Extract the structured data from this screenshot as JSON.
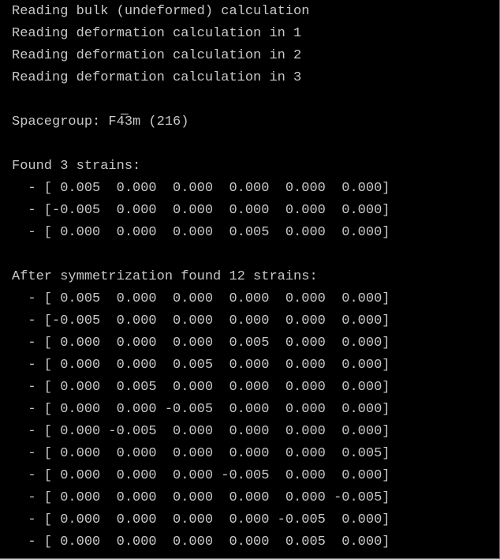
{
  "terminal": {
    "text_color": "#c8c8c8",
    "background": "#000000",
    "lines": [
      "Reading bulk (undeformed) calculation",
      "Reading deformation calculation in 1",
      "Reading deformation calculation in 2",
      "Reading deformation calculation in 3",
      "",
      "Spacegroup: F4̅3m (216)",
      "",
      "Found 3 strains:",
      "  - [ 0.005  0.000  0.000  0.000  0.000  0.000]",
      "  - [-0.005  0.000  0.000  0.000  0.000  0.000]",
      "  - [ 0.000  0.000  0.000  0.005  0.000  0.000]",
      "",
      "After symmetrization found 12 strains:",
      "  - [ 0.005  0.000  0.000  0.000  0.000  0.000]",
      "  - [-0.005  0.000  0.000  0.000  0.000  0.000]",
      "  - [ 0.000  0.000  0.000  0.005  0.000  0.000]",
      "  - [ 0.000  0.000  0.005  0.000  0.000  0.000]",
      "  - [ 0.000  0.005  0.000  0.000  0.000  0.000]",
      "  - [ 0.000  0.000 -0.005  0.000  0.000  0.000]",
      "  - [ 0.000 -0.005  0.000  0.000  0.000  0.000]",
      "  - [ 0.000  0.000  0.000  0.000  0.000  0.005]",
      "  - [ 0.000  0.000  0.000 -0.005  0.000  0.000]",
      "  - [ 0.000  0.000  0.000  0.000  0.000 -0.005]",
      "  - [ 0.000  0.000  0.000  0.000 -0.005  0.000]",
      "  - [ 0.000  0.000  0.000  0.000  0.005  0.000]"
    ]
  }
}
